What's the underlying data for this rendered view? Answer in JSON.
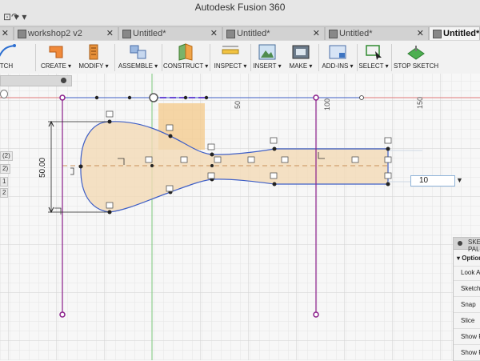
{
  "app": {
    "title": "Autodesk Fusion 360"
  },
  "tabs": [
    {
      "label": "workshop2 v2",
      "active": false
    },
    {
      "label": "Untitled*",
      "active": false
    },
    {
      "label": "Untitled*",
      "active": false
    },
    {
      "label": "Untitled*",
      "active": false
    },
    {
      "label": "Untitled*",
      "active": true
    }
  ],
  "toolbar": {
    "sketch_label": "TCH",
    "create_label": "CREATE ▾",
    "modify_label": "MODIFY ▾",
    "assemble_label": "ASSEMBLE ▾",
    "construct_label": "CONSTRUCT ▾",
    "inspect_label": "INSPECT ▾",
    "insert_label": "INSERT ▾",
    "make_label": "MAKE ▾",
    "addins_label": "ADD-INS ▾",
    "select_label": "SELECT ▾",
    "stop_label": "STOP SKETCH"
  },
  "ruler": {
    "ticks": [
      "50",
      "100",
      "150"
    ]
  },
  "dimension": {
    "height": "50.00",
    "input_value": "10"
  },
  "side_labels": [
    "(2)",
    "2)",
    "1",
    "2"
  ],
  "sketch_palette": {
    "title": "SKETCH PALETTE",
    "options_header": "Options",
    "items": [
      "Look At",
      "Sketch Grid",
      "Snap",
      "Slice",
      "Show Profile",
      "Show Points",
      "Show Constraints"
    ]
  },
  "colors": {
    "profile_fill": "#f3d9b5",
    "profile_stroke": "#3f5fc6",
    "axis_red": "#e07a7a",
    "axis_green": "#7ac77a",
    "construction": "#b5472f",
    "anchor_purple": "#8a1e8a"
  }
}
